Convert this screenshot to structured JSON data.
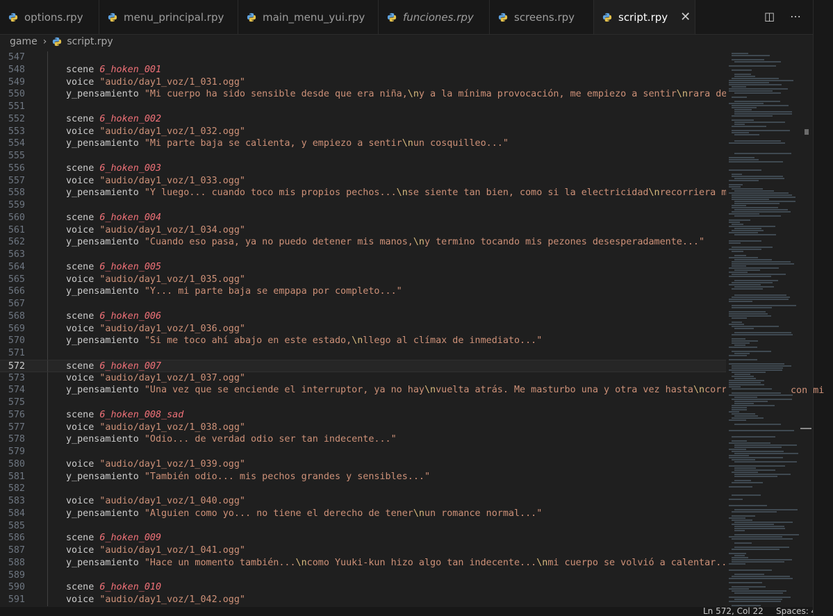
{
  "tabs": [
    {
      "label": "options.rpy",
      "active": false,
      "italic": false
    },
    {
      "label": "menu_principal.rpy",
      "active": false,
      "italic": false
    },
    {
      "label": "main_menu_yui.rpy",
      "active": false,
      "italic": false
    },
    {
      "label": "funciones.rpy",
      "active": false,
      "italic": true
    },
    {
      "label": "screens.rpy",
      "active": false,
      "italic": false
    },
    {
      "label": "script.rpy",
      "active": true,
      "italic": false
    }
  ],
  "icons": {
    "file": "python-file-icon",
    "close": "close-icon",
    "split": "split-editor-icon",
    "more": "more-actions-icon"
  },
  "breadcrumb": {
    "folder": "game",
    "file": "script.rpy"
  },
  "editor": {
    "current_line": 572,
    "lines": [
      {
        "n": "547",
        "t": ""
      },
      {
        "n": "548",
        "t": "scene <i>6_hoken_001</i>"
      },
      {
        "n": "549",
        "t": "voice <s>\"audio/day1_voz/1_031.ogg\"</s>"
      },
      {
        "n": "550",
        "t": "y_pensamiento <s>\"Mi cuerpo ha sido sensible desde que era niña,<e>\\n</e>y a la mínima provocación, me empiezo a sentir<e>\\n</e>rara de inmediato...</s>"
      },
      {
        "n": "551",
        "t": ""
      },
      {
        "n": "552",
        "t": "scene <i>6_hoken_002</i>"
      },
      {
        "n": "553",
        "t": "voice <s>\"audio/day1_voz/1_032.ogg\"</s>"
      },
      {
        "n": "554",
        "t": "y_pensamiento <s>\"Mi parte baja se calienta, y empiezo a sentir<e>\\n</e>un cosquilleo...\"</s>"
      },
      {
        "n": "555",
        "t": ""
      },
      {
        "n": "556",
        "t": "scene <i>6_hoken_003</i>"
      },
      {
        "n": "557",
        "t": "voice <s>\"audio/day1_voz/1_033.ogg\"</s>"
      },
      {
        "n": "558",
        "t": "y_pensamiento <s>\"Y luego... cuando toco mis propios pechos...<e>\\n</e>se siente tan bien, como si la electricidad<e>\\n</e>recorriera mi cuerpo...\"</s>"
      },
      {
        "n": "559",
        "t": ""
      },
      {
        "n": "560",
        "t": "scene <i>6_hoken_004</i>"
      },
      {
        "n": "561",
        "t": "voice <s>\"audio/day1_voz/1_034.ogg\"</s>"
      },
      {
        "n": "562",
        "t": "y_pensamiento <s>\"Cuando eso pasa, ya no puedo detener mis manos,<e>\\n</e>y termino tocando mis pezones desesperadamente...\"</s>"
      },
      {
        "n": "563",
        "t": ""
      },
      {
        "n": "564",
        "t": "scene <i>6_hoken_005</i>"
      },
      {
        "n": "565",
        "t": "voice <s>\"audio/day1_voz/1_035.ogg\"</s>"
      },
      {
        "n": "566",
        "t": "y_pensamiento <s>\"Y... mi parte baja se empapa por completo...\"</s>"
      },
      {
        "n": "567",
        "t": ""
      },
      {
        "n": "568",
        "t": "scene <i>6_hoken_006</i>"
      },
      {
        "n": "569",
        "t": "voice <s>\"audio/day1_voz/1_036.ogg\"</s>"
      },
      {
        "n": "570",
        "t": "y_pensamiento <s>\"Si me toco ahí abajo en este estado,<e>\\n</e>llego al clímax de inmediato...\"</s>"
      },
      {
        "n": "571",
        "t": ""
      },
      {
        "n": "572",
        "t": "scene <i>6_hoken_007</i>"
      },
      {
        "n": "573",
        "t": "voice <s>\"audio/day1_voz/1_037.ogg\"</s>"
      },
      {
        "n": "574",
        "t": "y_pensamiento <s>\"Una vez que se enciende el interruptor, ya no hay<e>\\n</e>vuelta atrás. Me masturbo una y otra vez hasta<e>\\n</e>correrme múltipl</s>"
      },
      {
        "n": "575",
        "t": ""
      },
      {
        "n": "576",
        "t": "scene <i>6_hoken_008_sad</i>"
      },
      {
        "n": "577",
        "t": "voice <s>\"audio/day1_voz/1_038.ogg\"</s>"
      },
      {
        "n": "578",
        "t": "y_pensamiento <s>\"Odio... de verdad odio ser tan indecente...\"</s>"
      },
      {
        "n": "579",
        "t": ""
      },
      {
        "n": "580",
        "t": "voice <s>\"audio/day1_voz/1_039.ogg\"</s>"
      },
      {
        "n": "581",
        "t": "y_pensamiento <s>\"También odio... mis pechos grandes y sensibles...\"</s>"
      },
      {
        "n": "582",
        "t": ""
      },
      {
        "n": "583",
        "t": "voice <s>\"audio/day1_voz/1_040.ogg\"</s>"
      },
      {
        "n": "584",
        "t": "y_pensamiento <s>\"Alguien como yo... no tiene el derecho de tener<e>\\n</e>un romance normal...\"</s>"
      },
      {
        "n": "585",
        "t": ""
      },
      {
        "n": "586",
        "t": "scene <i>6_hoken_009</i>"
      },
      {
        "n": "587",
        "t": "voice <s>\"audio/day1_voz/1_041.ogg\"</s>"
      },
      {
        "n": "588",
        "t": "y_pensamiento <s>\"Hace un momento también...<e>\\n</e>como Yuuki-kun hizo algo tan indecente...<e>\\n</e>mi cuerpo se volvió a calentar...\"</s>"
      },
      {
        "n": "589",
        "t": ""
      },
      {
        "n": "590",
        "t": "scene <i>6_hoken_010</i>"
      },
      {
        "n": "591",
        "t": "voice <s>\"audio/day1_voz/1_042.ogg\"</s>"
      }
    ]
  },
  "overflow_text": "con mi",
  "statusbar": {
    "position": "Ln 572, Col 22",
    "spaces": "Spaces: 4"
  },
  "colors": {
    "string": "#ce9178",
    "image_name": "#f07178",
    "escape": "#d7ba7d",
    "bg": "#1f1f1f"
  }
}
